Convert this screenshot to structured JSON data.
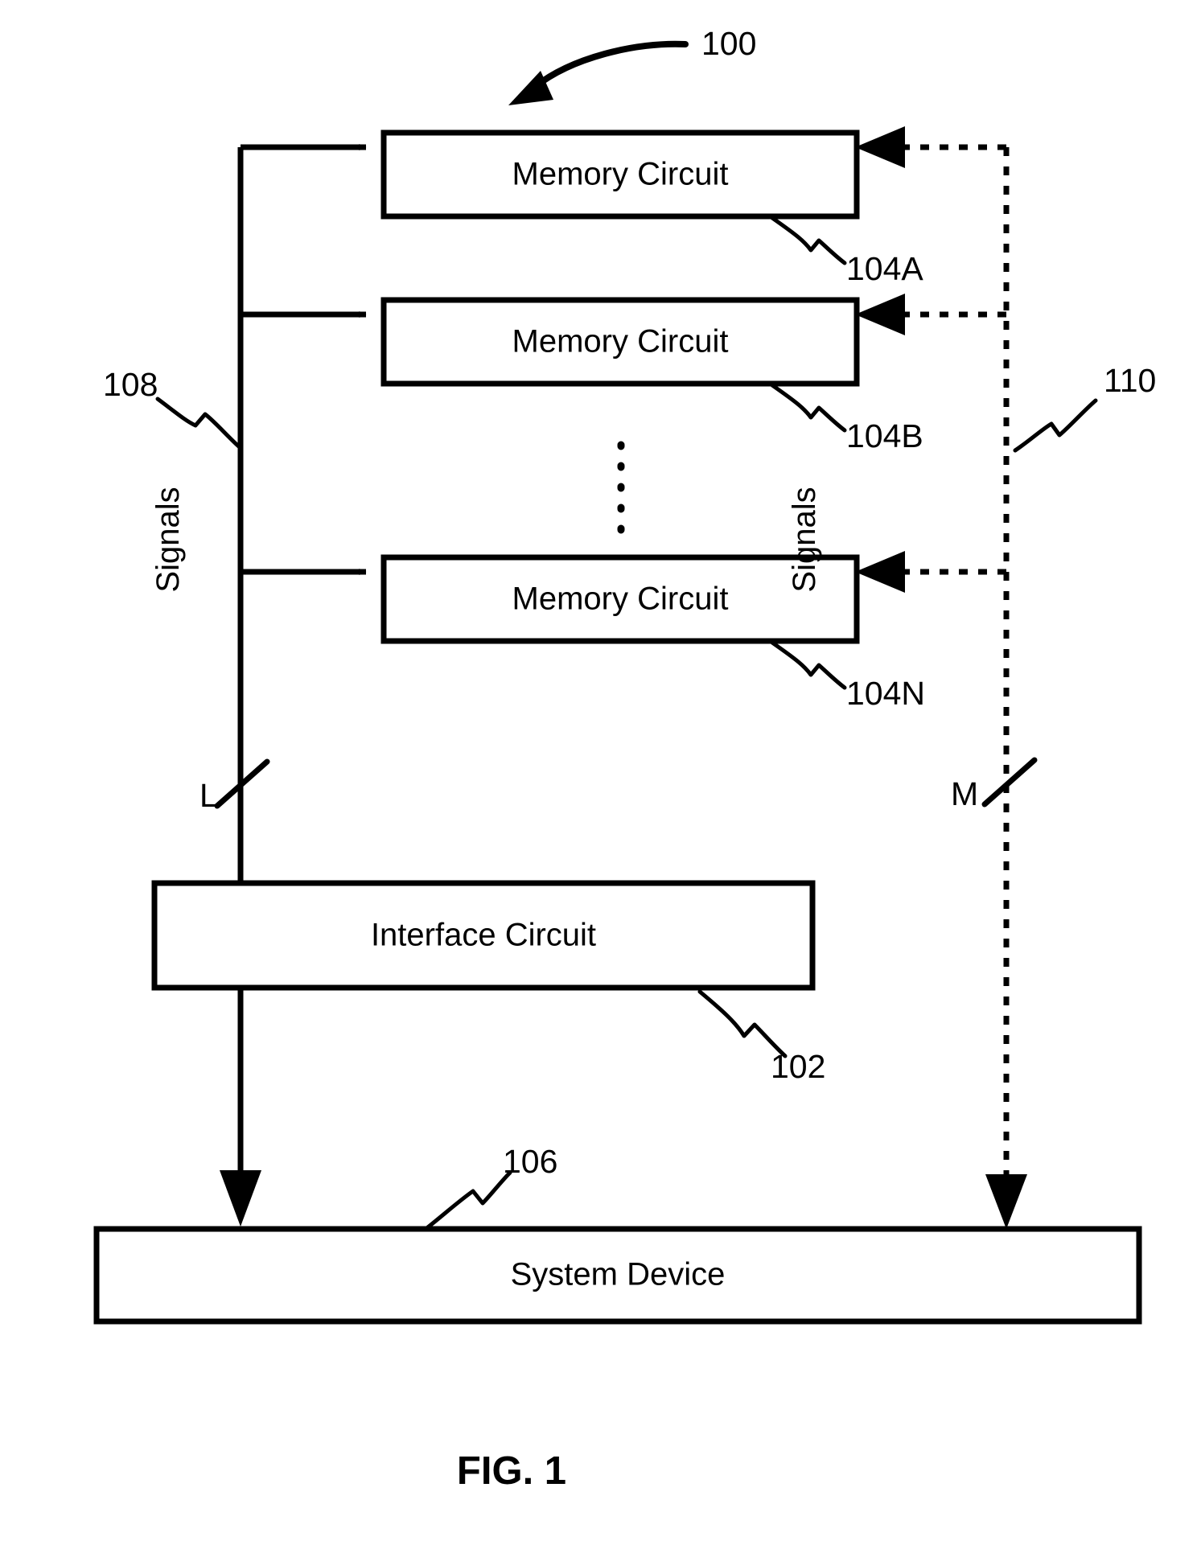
{
  "figure": {
    "caption": "FIG. 1",
    "system_ref": "100"
  },
  "blocks": [
    {
      "id": "memory-a",
      "label": "Memory Circuit",
      "ref": "104A"
    },
    {
      "id": "memory-b",
      "label": "Memory Circuit",
      "ref": "104B"
    },
    {
      "id": "memory-n",
      "label": "Memory Circuit",
      "ref": "104N"
    },
    {
      "id": "interface",
      "label": "Interface Circuit",
      "ref": "102"
    },
    {
      "id": "system-device",
      "label": "System Device",
      "ref": "106"
    }
  ],
  "buses": {
    "left": {
      "ref": "108",
      "signals_label": "Signals",
      "width_letter": "L",
      "style": "solid"
    },
    "right": {
      "ref": "110",
      "signals_label": "Signals",
      "width_letter": "M",
      "style": "dotted"
    }
  },
  "colors": {
    "ink": "#000000",
    "paper": "#ffffff"
  }
}
